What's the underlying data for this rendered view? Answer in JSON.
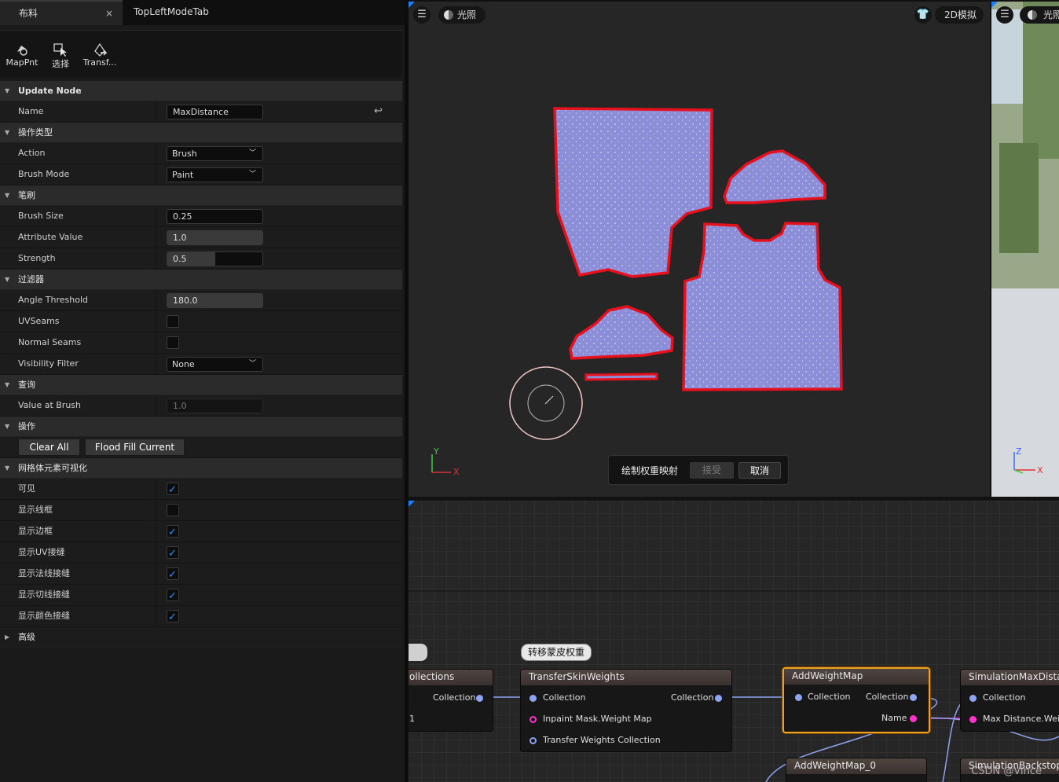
{
  "tabs": {
    "panel_tab": "布料",
    "close_glyph": "×",
    "second_tab": "TopLeftModeTab"
  },
  "toolbar": [
    {
      "label": "MapPnt",
      "icon": "map-point-icon"
    },
    {
      "label": "选择",
      "icon": "select-cursor-icon"
    },
    {
      "label": "Transf...",
      "icon": "transfer-icon"
    }
  ],
  "sections": {
    "update_node": "Update Node",
    "op_type": "操作类型",
    "brush": "笔刷",
    "filter": "过滤器",
    "query": "查询",
    "operation": "操作",
    "mesh_vis": "网格体元素可视化",
    "advanced": "高级"
  },
  "props": {
    "name_label": "Name",
    "name_value": "MaxDistance",
    "action_label": "Action",
    "action_value": "Brush",
    "brush_mode_label": "Brush Mode",
    "brush_mode_value": "Paint",
    "brush_size_label": "Brush Size",
    "brush_size_value": "0.25",
    "brush_size_fill": 0.0,
    "attr_label": "Attribute Value",
    "attr_value": "1.0",
    "attr_fill": 1.0,
    "strength_label": "Strength",
    "strength_value": "0.5",
    "strength_fill": 0.5,
    "angle_label": "Angle Threshold",
    "angle_value": "180.0",
    "angle_fill": 1.0,
    "uvseams_label": "UVSeams",
    "uvseams_checked": false,
    "normal_label": "Normal Seams",
    "normal_checked": false,
    "visfilter_label": "Visibility Filter",
    "visfilter_value": "None",
    "value_brush_label": "Value at Brush",
    "value_brush_value": "1.0",
    "clear_all": "Clear All",
    "flood_fill": "Flood Fill Current"
  },
  "mesh_vis": [
    {
      "label": "可见",
      "checked": true
    },
    {
      "label": "显示线框",
      "checked": false
    },
    {
      "label": "显示边框",
      "checked": true
    },
    {
      "label": "显示UV接缝",
      "checked": true
    },
    {
      "label": "显示法线接缝",
      "checked": true
    },
    {
      "label": "显示切线接缝",
      "checked": true
    },
    {
      "label": "显示颜色接缝",
      "checked": true
    }
  ],
  "viewport": {
    "lighting": "光照",
    "mode_2d": "2D模拟",
    "paint_prompt": "绘制权重映射",
    "accept": "接受",
    "cancel": "取消",
    "axis_y": "Y",
    "axis_x": "X"
  },
  "right_viewport": {
    "lighting": "光照",
    "axis_z": "Z",
    "axis_x": "X"
  },
  "graph": {
    "comment": "转移蒙皮权重",
    "nodes": {
      "collections_title": "ollections",
      "collections_out": "Collection",
      "collections_row2": "1",
      "transfer_title": "TransferSkinWeights",
      "transfer_in": "Collection",
      "transfer_out": "Collection",
      "transfer_mask": "Inpaint Mask.Weight Map",
      "transfer_weights": "Transfer Weights Collection",
      "add_title": "AddWeightMap",
      "add_in": "Collection",
      "add_out": "Collection",
      "add_name": "Name",
      "sim_title": "SimulationMaxDistanc",
      "sim_in": "Collection",
      "sim_max": "Max Distance.Weig",
      "add0_title": "AddWeightMap_0",
      "backstop_title": "SimulationBackstopC"
    },
    "watermark": "CSDN @Vince"
  },
  "colors": {
    "accent": "#1e7fff",
    "pin_collection": "#8ea4f0",
    "pin_name": "#ff33cc",
    "selected": "#f0a020",
    "pattern_fill": "#8c8fd8",
    "pattern_border": "#e8101c"
  }
}
